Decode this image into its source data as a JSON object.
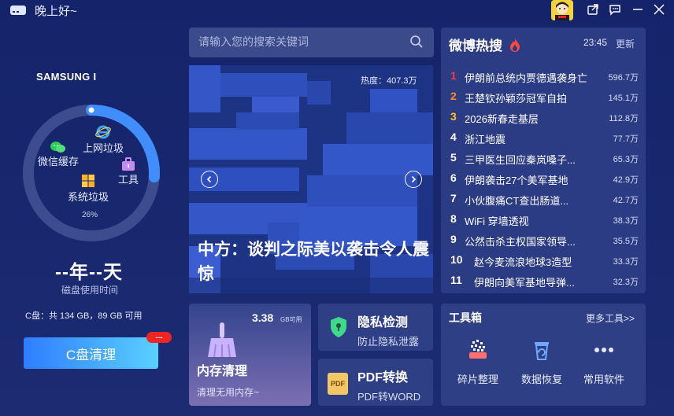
{
  "titlebar": {
    "greeting": "晚上好~",
    "icons": [
      "drive-icon",
      "avatar",
      "share-icon",
      "message-icon",
      "minimize-icon",
      "close-icon"
    ]
  },
  "disk": {
    "name": "SAMSUNG I",
    "ring_items": {
      "wechat": "微信缓存",
      "internet": "上网垃圾",
      "tools": "工具",
      "system": "系统垃圾"
    },
    "usage_percent_label": "26%",
    "usage_fraction": 0.26,
    "days": "--年--天",
    "days_label": "磁盘使用时间",
    "c_info": "C盘：共 134 GB，89 GB 可用",
    "clean_button": "C盘清理",
    "badge": "---"
  },
  "search": {
    "placeholder": "请输入您的搜索关键词"
  },
  "banner": {
    "heat": "热度：407.3万",
    "headline": "中方：谈判之际美以袭击令人震惊"
  },
  "hot": {
    "title": "微博热搜",
    "time": "23:45",
    "refresh": "更新",
    "rank_colors": [
      "#ff3b3b",
      "#ff8a1f",
      "#ffc21f"
    ],
    "items": [
      {
        "rank": "1",
        "text": "伊朗前总统内贾德遇袭身亡",
        "value": "596.7万"
      },
      {
        "rank": "2",
        "text": "王楚钦孙颖莎冠军自拍",
        "value": "145.1万"
      },
      {
        "rank": "3",
        "text": "2026新春走基层",
        "value": "112.8万"
      },
      {
        "rank": "4",
        "text": "浙江地震",
        "value": "77.7万"
      },
      {
        "rank": "5",
        "text": "三甲医生回应秦岚嗓子...",
        "value": "65.3万"
      },
      {
        "rank": "6",
        "text": "伊朗袭击27个美军基地",
        "value": "42.9万"
      },
      {
        "rank": "7",
        "text": "小伙腹痛CT查出肠道...",
        "value": "42.7万"
      },
      {
        "rank": "8",
        "text": "WiFi 穿墙透视",
        "value": "38.3万"
      },
      {
        "rank": "9",
        "text": "公然击杀主权国家领导...",
        "value": "35.5万"
      },
      {
        "rank": "10",
        "text": "赵今麦流浪地球3造型",
        "value": "33.3万"
      },
      {
        "rank": "11",
        "text": "伊朗向美军基地导弹...",
        "value": "32.3万"
      }
    ]
  },
  "memory": {
    "value": "3.38",
    "unit": "GB可用",
    "title": "内存清理",
    "subtitle": "清理无用内存~"
  },
  "privacy": {
    "title": "隐私检测",
    "subtitle": "防止隐私泄露"
  },
  "pdf": {
    "icon_text": "PDF",
    "title": "PDF转换",
    "subtitle": "PDF转WORD"
  },
  "toolbox": {
    "title": "工具箱",
    "more": "更多工具>>",
    "tools": [
      {
        "label": "碎片整理",
        "icon": "defrag-icon"
      },
      {
        "label": "数据恢复",
        "icon": "data-recovery-icon"
      },
      {
        "label": "常用软件",
        "icon": "more-dots-icon"
      }
    ]
  }
}
